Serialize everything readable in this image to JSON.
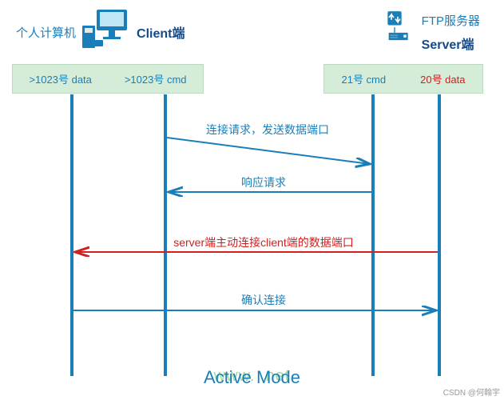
{
  "client": {
    "label_cn": "个人计算机",
    "label_en": "Client端",
    "port_data": ">1023号 data",
    "port_cmd": ">1023号 cmd"
  },
  "server": {
    "label_cn": "FTP服务器",
    "label_en": "Server端",
    "port_cmd": "21号 cmd",
    "port_data": "20号 data"
  },
  "messages": {
    "m1": "连接请求，发送数据端口",
    "m2": "响应请求",
    "m3": "server端主动连接client端的数据端口",
    "m4": "确认连接"
  },
  "title": "Active Mode",
  "watermark_url": "www.      .net",
  "watermark_author": "CSDN @何翰宇"
}
